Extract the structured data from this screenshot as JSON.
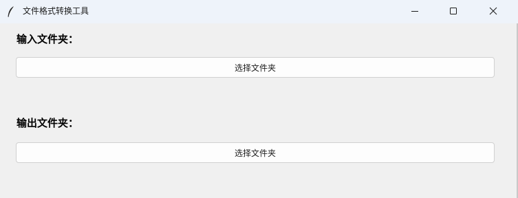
{
  "window": {
    "title": "文件格式转换工具",
    "icon": "feather-icon",
    "controls": {
      "minimize_icon": "minimize-icon",
      "maximize_icon": "maximize-icon",
      "close_icon": "close-icon"
    }
  },
  "input_section": {
    "label": "输入文件夹：",
    "button_label": "选择文件夹"
  },
  "output_section": {
    "label": "输出文件夹：",
    "button_label": "选择文件夹"
  }
}
